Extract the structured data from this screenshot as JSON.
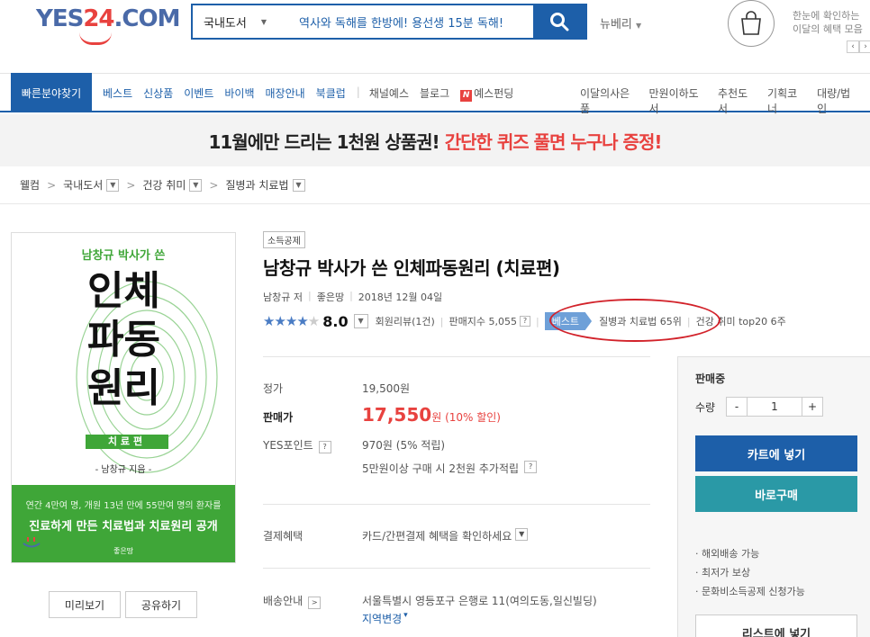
{
  "header": {
    "logo_main": "YES",
    "logo_num": "24",
    "logo_suffix": ".COM",
    "search_category": "국내도서",
    "search_query": "역사와 독해를 한방에! 용선생 15분 독해!",
    "newberry": "뉴베리",
    "promo_line1": "한눈에 확인하는",
    "promo_line2": "이달의 혜택 모음"
  },
  "nav": {
    "quick": "빠른분야찾기",
    "items": [
      "베스트",
      "신상품",
      "이벤트",
      "바이백",
      "매장안내",
      "북클럽",
      "채널예스",
      "블로그",
      "예스펀딩"
    ],
    "right_items": [
      "이달의사은품",
      "만원이하도서",
      "추천도서",
      "기획코너",
      "대량/법인"
    ]
  },
  "banner": {
    "part1": "11월에만 드리는 1천원 상품권!",
    "part2": "간단한 퀴즈 풀면 누구나 증정!"
  },
  "breadcrumb": [
    "웰컴",
    "국내도서",
    "건강 취미",
    "질병과 치료법"
  ],
  "cover": {
    "subtitle": "남창규 박사가 쓴",
    "big_line1": "인체",
    "big_line2": "파동",
    "big_line3": "원리",
    "tag": "치료편",
    "author": "- 남창규 지음 -",
    "band_line1": "연간 4만여 명, 개원 13년 만에 55만여 명의 환자를",
    "band_line2": "진료하게 만든 치료법과 치료원리 공개",
    "publisher": "좋은땅"
  },
  "cover_buttons": {
    "preview": "미리보기",
    "share": "공유하기"
  },
  "product": {
    "badge": "소득공제",
    "title": "남창규 박사가 쓴 인체파동원리 (치료편)",
    "author": "남창규 저",
    "publisher": "좋은땅",
    "date": "2018년 12월 04일",
    "rating": 8.0,
    "rating_text": "8.0",
    "review": "회원리뷰(1건)",
    "sales_index": "판매지수 5,055",
    "best_label": "베스트",
    "best_rank": "질병과 치료법 65위",
    "hobby_rank": "건강 취미 top20 6주"
  },
  "price": {
    "list_label": "정가",
    "list_value": "19,500원",
    "sale_label": "판매가",
    "sale_value": "17,550",
    "sale_unit": "원",
    "discount": "(10% 할인)",
    "point_label": "YES포인트",
    "point_value": "970원 (5% 적립)",
    "extra": "5만원이상 구매 시 2천원 추가적립",
    "benefit_label": "결제혜택",
    "benefit_value": "카드/간편결제 혜택을 확인하세요",
    "ship_label": "배송안내",
    "ship_value": "서울특별시 영등포구 은행로 11(여의도동,일신빌딩)",
    "region_change": "지역변경"
  },
  "buy": {
    "status": "판매중",
    "qty_label": "수량",
    "qty_minus": "-",
    "qty_value": "1",
    "qty_plus": "+",
    "cart": "카트에 넣기",
    "buy_now": "바로구매",
    "benefits": [
      "· 해외배송 가능",
      "· 최저가 보상",
      "· 문화비소득공제 신청가능"
    ],
    "list": "리스트에 넣기"
  },
  "colors": {
    "brand_blue": "#1d5fa9",
    "accent_red": "#e8423f",
    "cover_green": "#3fa638",
    "buy_teal": "#2a99a6"
  }
}
